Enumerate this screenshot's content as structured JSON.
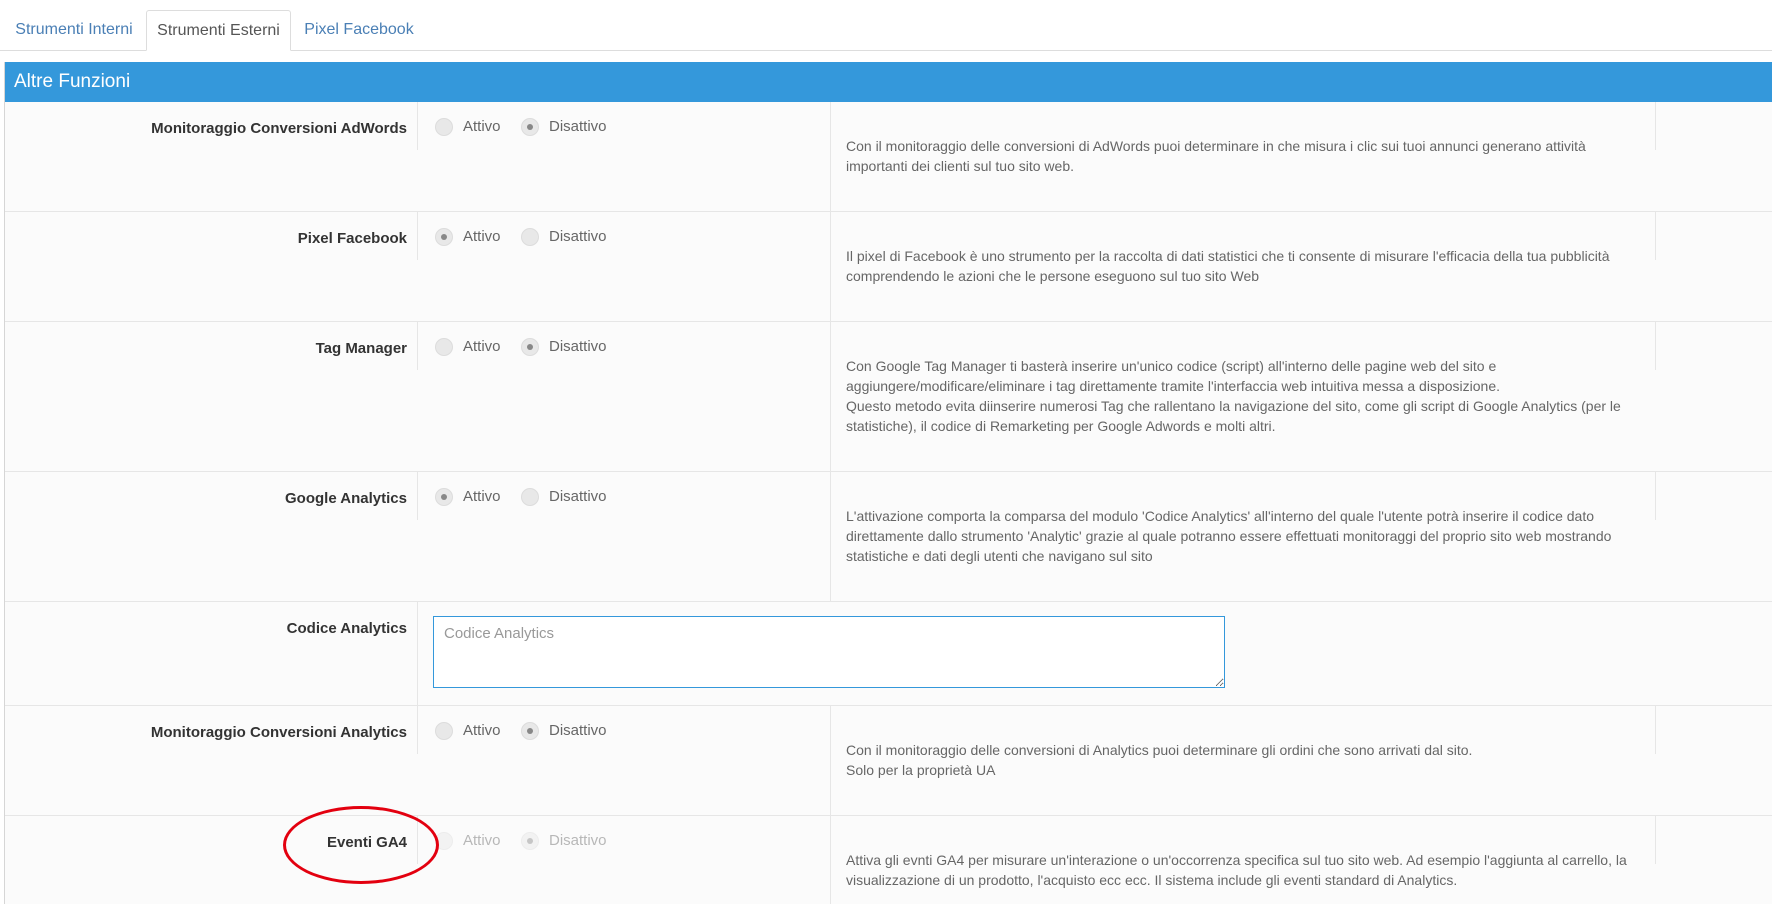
{
  "tabs": [
    {
      "label": "Strumenti Interni",
      "active": false
    },
    {
      "label": "Strumenti Esterni",
      "active": true
    },
    {
      "label": "Pixel Facebook",
      "active": false
    }
  ],
  "panel": {
    "title": "Altre Funzioni",
    "header_color": "#3498db"
  },
  "options": {
    "on": "Attivo",
    "off": "Disattivo"
  },
  "rows": [
    {
      "label": "Monitoraggio Conversioni AdWords",
      "selected": "Disattivo",
      "description": "Con il monitoraggio delle conversioni di AdWords puoi determinare in che misura i clic sui tuoi annunci generano attività importanti dei clienti sul tuo sito web."
    },
    {
      "label": "Pixel Facebook",
      "selected": "Attivo",
      "description": "Il pixel di Facebook è uno strumento per la raccolta di dati statistici che ti consente di misurare l'efficacia della tua pubblicità comprendendo le azioni che le persone eseguono sul tuo sito Web"
    },
    {
      "label": "Tag Manager",
      "selected": "Disattivo",
      "description": "Con Google Tag Manager ti basterà inserire un'unico codice (script) all'interno delle pagine web del sito e aggiungere/modificare/eliminare i tag direttamente tramite l'interfaccia web intuitiva messa a disposizione.\nQuesto metodo evita diinserire numerosi Tag che rallentano la navigazione del sito, come gli script di Google Analytics (per le statistiche), il codice di Remarketing per Google Adwords e molti altri."
    },
    {
      "label": "Google Analytics",
      "selected": "Attivo",
      "description": "L'attivazione comporta la comparsa del modulo 'Codice Analytics' all'interno del quale l'utente potrà inserire il codice dato direttamente dallo strumento 'Analytic' grazie al quale potranno essere effettuati monitoraggi del proprio sito web mostrando statistiche e dati degli utenti che navigano sul sito"
    },
    {
      "label": "Codice Analytics",
      "placeholder": "Codice Analytics",
      "value": ""
    },
    {
      "label": "Monitoraggio Conversioni Analytics",
      "selected": "Disattivo",
      "description": "Con il monitoraggio delle conversioni di Analytics puoi determinare gli ordini che sono arrivati dal sito.\nSolo per la proprietà UA"
    },
    {
      "label": "Eventi GA4",
      "selected": "Disattivo",
      "disabled": true,
      "description": "Attiva gli evnti GA4 per misurare un'interazione o un'occorrenza specifica sul tuo sito web. Ad esempio l'aggiunta al carrello, la visualizzazione di un prodotto, l'acquisto ecc ecc. Il sistema include gli eventi standard di Analytics."
    }
  ],
  "annotation": {
    "shape": "ellipse",
    "color": "#e3000f",
    "target": "Eventi GA4"
  }
}
